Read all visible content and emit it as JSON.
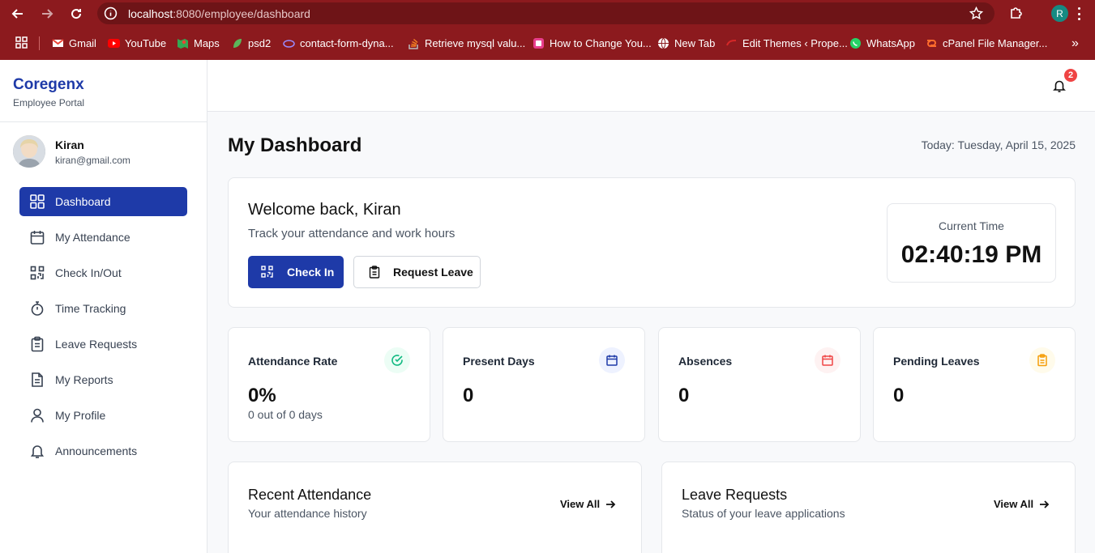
{
  "browser": {
    "url_host": "localhost",
    "url_path": ":8080/employee/dashboard",
    "profile_initial": "R",
    "bookmarks": [
      {
        "label": "Gmail",
        "icon": "gmail-icon",
        "color": "#ea4335"
      },
      {
        "label": "YouTube",
        "icon": "youtube-icon",
        "color": "#ff0000"
      },
      {
        "label": "Maps",
        "icon": "maps-icon",
        "color": "#34a853"
      },
      {
        "label": "psd2",
        "icon": "leaf-icon",
        "color": "#5bb75b"
      },
      {
        "label": "contact-form-dyna...",
        "icon": "cloud-icon",
        "color": "#9a8cff"
      },
      {
        "label": "Retrieve mysql valu...",
        "icon": "stackoverflow-icon",
        "color": "#f48024"
      },
      {
        "label": "How to Change You...",
        "icon": "site-icon",
        "color": "#e83e8c"
      },
      {
        "label": "New Tab",
        "icon": "globe-icon",
        "color": "#ffffff"
      },
      {
        "label": "Edit Themes ‹ Prope...",
        "icon": "theme-icon",
        "color": "#d62828"
      },
      {
        "label": "WhatsApp",
        "icon": "whatsapp-icon",
        "color": "#25d366"
      },
      {
        "label": "cPanel File Manager...",
        "icon": "cpanel-icon",
        "color": "#ff6c2c"
      }
    ]
  },
  "sidebar": {
    "brand": "Coregenx",
    "brand_sub": "Employee Portal",
    "user": {
      "name": "Kiran",
      "email": "kiran@gmail.com"
    },
    "items": [
      {
        "label": "Dashboard",
        "icon": "dashboard-icon",
        "active": true
      },
      {
        "label": "My Attendance",
        "icon": "calendar-icon"
      },
      {
        "label": "Check In/Out",
        "icon": "qr-icon"
      },
      {
        "label": "Time Tracking",
        "icon": "stopwatch-icon"
      },
      {
        "label": "Leave Requests",
        "icon": "clipboard-icon"
      },
      {
        "label": "My Reports",
        "icon": "document-icon"
      },
      {
        "label": "My Profile",
        "icon": "user-icon"
      },
      {
        "label": "Announcements",
        "icon": "bell-icon"
      }
    ]
  },
  "header": {
    "notification_count": "2"
  },
  "main": {
    "title": "My Dashboard",
    "today": "Today: Tuesday, April 15, 2025",
    "welcome": {
      "title": "Welcome back, Kiran",
      "subtitle": "Track your attendance and work hours",
      "check_in_label": "Check In",
      "request_leave_label": "Request Leave",
      "current_time_label": "Current Time",
      "current_time": "02:40:19 PM"
    },
    "stats": [
      {
        "label": "Attendance Rate",
        "value": "0%",
        "sub": "0 out of 0 days",
        "icon": "check-circle-icon",
        "color": "#10b981",
        "bg": "#ecfdf5"
      },
      {
        "label": "Present Days",
        "value": "0",
        "sub": "",
        "icon": "calendar-icon",
        "color": "#1e3aa8",
        "bg": "#eef2ff"
      },
      {
        "label": "Absences",
        "value": "0",
        "sub": "",
        "icon": "calendar-icon",
        "color": "#ef4444",
        "bg": "#fef2f2"
      },
      {
        "label": "Pending Leaves",
        "value": "0",
        "sub": "",
        "icon": "clipboard-icon",
        "color": "#f59e0b",
        "bg": "#fffbeb"
      }
    ],
    "panels": [
      {
        "title": "Recent Attendance",
        "subtitle": "Your attendance history",
        "link": "View All"
      },
      {
        "title": "Leave Requests",
        "subtitle": "Status of your leave applications",
        "link": "View All"
      }
    ]
  }
}
